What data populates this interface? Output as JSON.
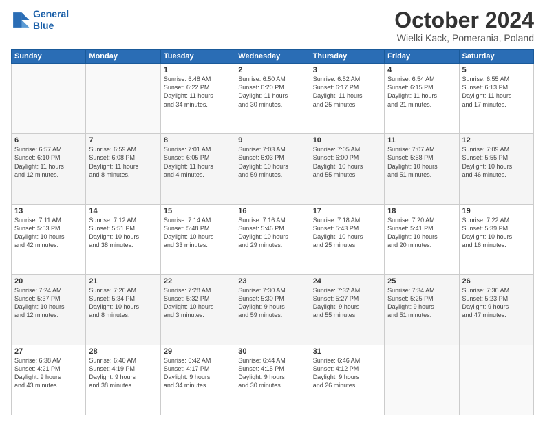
{
  "logo": {
    "line1": "General",
    "line2": "Blue"
  },
  "title": "October 2024",
  "location": "Wielki Kack, Pomerania, Poland",
  "weekdays": [
    "Sunday",
    "Monday",
    "Tuesday",
    "Wednesday",
    "Thursday",
    "Friday",
    "Saturday"
  ],
  "weeks": [
    [
      {
        "day": "",
        "info": ""
      },
      {
        "day": "",
        "info": ""
      },
      {
        "day": "1",
        "info": "Sunrise: 6:48 AM\nSunset: 6:22 PM\nDaylight: 11 hours\nand 34 minutes."
      },
      {
        "day": "2",
        "info": "Sunrise: 6:50 AM\nSunset: 6:20 PM\nDaylight: 11 hours\nand 30 minutes."
      },
      {
        "day": "3",
        "info": "Sunrise: 6:52 AM\nSunset: 6:17 PM\nDaylight: 11 hours\nand 25 minutes."
      },
      {
        "day": "4",
        "info": "Sunrise: 6:54 AM\nSunset: 6:15 PM\nDaylight: 11 hours\nand 21 minutes."
      },
      {
        "day": "5",
        "info": "Sunrise: 6:55 AM\nSunset: 6:13 PM\nDaylight: 11 hours\nand 17 minutes."
      }
    ],
    [
      {
        "day": "6",
        "info": "Sunrise: 6:57 AM\nSunset: 6:10 PM\nDaylight: 11 hours\nand 12 minutes."
      },
      {
        "day": "7",
        "info": "Sunrise: 6:59 AM\nSunset: 6:08 PM\nDaylight: 11 hours\nand 8 minutes."
      },
      {
        "day": "8",
        "info": "Sunrise: 7:01 AM\nSunset: 6:05 PM\nDaylight: 11 hours\nand 4 minutes."
      },
      {
        "day": "9",
        "info": "Sunrise: 7:03 AM\nSunset: 6:03 PM\nDaylight: 10 hours\nand 59 minutes."
      },
      {
        "day": "10",
        "info": "Sunrise: 7:05 AM\nSunset: 6:00 PM\nDaylight: 10 hours\nand 55 minutes."
      },
      {
        "day": "11",
        "info": "Sunrise: 7:07 AM\nSunset: 5:58 PM\nDaylight: 10 hours\nand 51 minutes."
      },
      {
        "day": "12",
        "info": "Sunrise: 7:09 AM\nSunset: 5:55 PM\nDaylight: 10 hours\nand 46 minutes."
      }
    ],
    [
      {
        "day": "13",
        "info": "Sunrise: 7:11 AM\nSunset: 5:53 PM\nDaylight: 10 hours\nand 42 minutes."
      },
      {
        "day": "14",
        "info": "Sunrise: 7:12 AM\nSunset: 5:51 PM\nDaylight: 10 hours\nand 38 minutes."
      },
      {
        "day": "15",
        "info": "Sunrise: 7:14 AM\nSunset: 5:48 PM\nDaylight: 10 hours\nand 33 minutes."
      },
      {
        "day": "16",
        "info": "Sunrise: 7:16 AM\nSunset: 5:46 PM\nDaylight: 10 hours\nand 29 minutes."
      },
      {
        "day": "17",
        "info": "Sunrise: 7:18 AM\nSunset: 5:43 PM\nDaylight: 10 hours\nand 25 minutes."
      },
      {
        "day": "18",
        "info": "Sunrise: 7:20 AM\nSunset: 5:41 PM\nDaylight: 10 hours\nand 20 minutes."
      },
      {
        "day": "19",
        "info": "Sunrise: 7:22 AM\nSunset: 5:39 PM\nDaylight: 10 hours\nand 16 minutes."
      }
    ],
    [
      {
        "day": "20",
        "info": "Sunrise: 7:24 AM\nSunset: 5:37 PM\nDaylight: 10 hours\nand 12 minutes."
      },
      {
        "day": "21",
        "info": "Sunrise: 7:26 AM\nSunset: 5:34 PM\nDaylight: 10 hours\nand 8 minutes."
      },
      {
        "day": "22",
        "info": "Sunrise: 7:28 AM\nSunset: 5:32 PM\nDaylight: 10 hours\nand 3 minutes."
      },
      {
        "day": "23",
        "info": "Sunrise: 7:30 AM\nSunset: 5:30 PM\nDaylight: 9 hours\nand 59 minutes."
      },
      {
        "day": "24",
        "info": "Sunrise: 7:32 AM\nSunset: 5:27 PM\nDaylight: 9 hours\nand 55 minutes."
      },
      {
        "day": "25",
        "info": "Sunrise: 7:34 AM\nSunset: 5:25 PM\nDaylight: 9 hours\nand 51 minutes."
      },
      {
        "day": "26",
        "info": "Sunrise: 7:36 AM\nSunset: 5:23 PM\nDaylight: 9 hours\nand 47 minutes."
      }
    ],
    [
      {
        "day": "27",
        "info": "Sunrise: 6:38 AM\nSunset: 4:21 PM\nDaylight: 9 hours\nand 43 minutes."
      },
      {
        "day": "28",
        "info": "Sunrise: 6:40 AM\nSunset: 4:19 PM\nDaylight: 9 hours\nand 38 minutes."
      },
      {
        "day": "29",
        "info": "Sunrise: 6:42 AM\nSunset: 4:17 PM\nDaylight: 9 hours\nand 34 minutes."
      },
      {
        "day": "30",
        "info": "Sunrise: 6:44 AM\nSunset: 4:15 PM\nDaylight: 9 hours\nand 30 minutes."
      },
      {
        "day": "31",
        "info": "Sunrise: 6:46 AM\nSunset: 4:12 PM\nDaylight: 9 hours\nand 26 minutes."
      },
      {
        "day": "",
        "info": ""
      },
      {
        "day": "",
        "info": ""
      }
    ]
  ]
}
